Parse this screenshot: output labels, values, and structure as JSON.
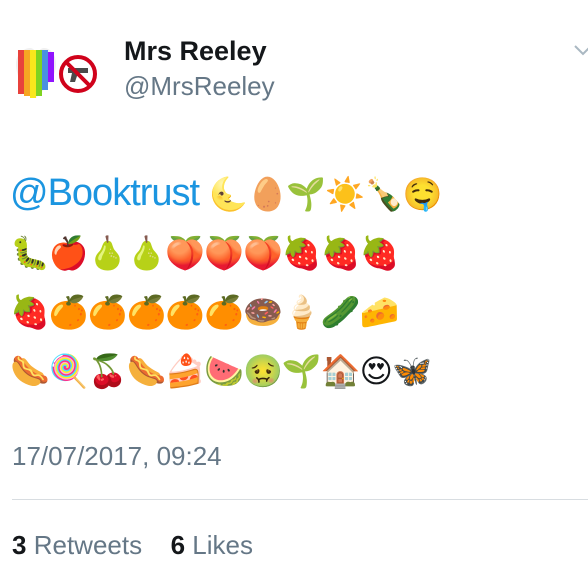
{
  "user": {
    "display_name": "Mrs Reeley",
    "handle": "@MrsReeley"
  },
  "avatar": {
    "description_icon": "rainbow-heart-and-no-guns-avatar",
    "colors": [
      "#e8423c",
      "#f6a623",
      "#f8e71c",
      "#7ed321",
      "#4a90e2",
      "#9013fe"
    ]
  },
  "tweet": {
    "mention": "@Booktrust",
    "emoji_line_1": "🌜🥚🌱☀️🍾🤤",
    "emoji_line_2": "🐛🍎🍐🍐🍑🍑🍑🍓🍓🍓",
    "emoji_line_3": "🍓🍊🍊🍊🍊🍊🍩🍦🥒🧀",
    "emoji_line_4": "🌭🍭🍒🌭🍰🍉🤢🌱🏠😍🦋"
  },
  "timestamp": "17/07/2017, 09:24",
  "stats": {
    "retweets_count": "3",
    "retweets_label": "Retweets",
    "likes_count": "6",
    "likes_label": "Likes"
  },
  "colors": {
    "link": "#1b95e0",
    "secondary_text": "#657786",
    "primary_text": "#14171a"
  }
}
